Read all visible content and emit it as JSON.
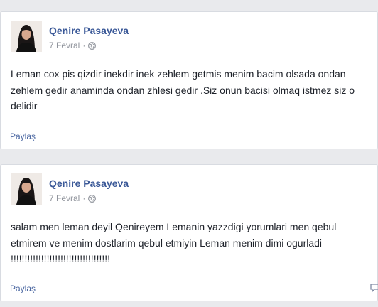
{
  "posts": [
    {
      "author": "Qenire Pasayeva",
      "date": "7 Fevral",
      "privacy_icon": "globe-icon",
      "text": "Leman cox pis qizdir inekdir inek zehlem getmis menim bacim olsada ondan zehlem gedir anaminda ondan zhlesi gedir .Siz onun bacisi olmaq istmez siz o delidir",
      "share_label": "Paylaş"
    },
    {
      "author": "Qenire Pasayeva",
      "date": "7 Fevral",
      "privacy_icon": "globe-icon",
      "text": "salam men leman deyil Qenireyem Lemanin yazzdigi yorumlari men qebul etmirem ve menim dostlarim qebul etmiyin Leman menim dimi ogurladi !!!!!!!!!!!!!!!!!!!!!!!!!!!!!!!!!!!!",
      "share_label": "Paylaş",
      "comment_icon": "comment-icon"
    }
  ],
  "colors": {
    "author_link": "#3b5998",
    "share_link": "#4b67a1",
    "muted": "#90949c",
    "page_bg": "#e9eaed"
  }
}
